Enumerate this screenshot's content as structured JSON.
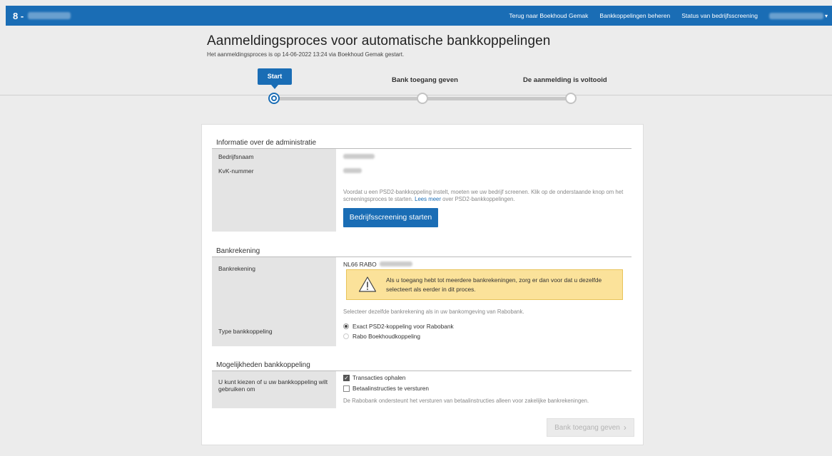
{
  "topbar": {
    "prefix": "8 -",
    "nav": [
      "Terug naar Boekhoud Gemak",
      "Bankkoppelingen beheren",
      "Status van bedrijfsscreening"
    ]
  },
  "header": {
    "title": "Aanmeldingsproces voor automatische bankkoppelingen",
    "subtitle": "Het aanmeldingsproces is op 14-06-2022 13:24 via Boekhoud Gemak gestart."
  },
  "steps": [
    {
      "label": "Start",
      "state": "active"
    },
    {
      "label": "Bank toegang geven",
      "state": "pending"
    },
    {
      "label": "De aanmelding is voltooid",
      "state": "pending"
    }
  ],
  "admin": {
    "title": "Informatie over de administratie",
    "company_label": "Bedrijfsnaam",
    "kvk_label": "KvK-nummer",
    "note_before": "Voordat u een PSD2-bankkoppeling instelt, moeten we uw bedrijf screenen. Klik op de onderstaande knop om het screeningsproces te starten.",
    "note_link": "Lees meer",
    "note_after": "over PSD2-bankkoppelingen.",
    "screening_button": "Bedrijfsscreening starten"
  },
  "bank": {
    "title": "Bankrekening",
    "account_label": "Bankrekening",
    "account_value": "NL66 RABO",
    "warning": "Als u toegang hebt tot meerdere bankrekeningen, zorg er dan voor dat u dezelfde selecteert als eerder in dit proces.",
    "hint": "Selecteer dezelfde bankrekening als in uw bankomgeving van Rabobank.",
    "type_label": "Type bankkoppeling",
    "options": [
      {
        "label": "Exact PSD2-koppeling voor Rabobank",
        "selected": true
      },
      {
        "label": "Rabo Boekhoudkoppeling",
        "selected": false
      }
    ]
  },
  "possibilities": {
    "title": "Mogelijkheden bankkoppeling",
    "label": "U kunt kiezen of u uw bankkoppeling wilt gebruiken om",
    "options": [
      {
        "label": "Transacties ophalen",
        "checked": true
      },
      {
        "label": "Betaalinstructies te versturen",
        "checked": false
      }
    ],
    "note": "De Rabobank ondersteunt het versturen van betaalinstructies alleen voor zakelijke bankrekeningen."
  },
  "footer": {
    "next_button": "Bank toegang geven"
  },
  "colors": {
    "primary": "#1a6db5",
    "warning_bg": "#fbe29a"
  }
}
